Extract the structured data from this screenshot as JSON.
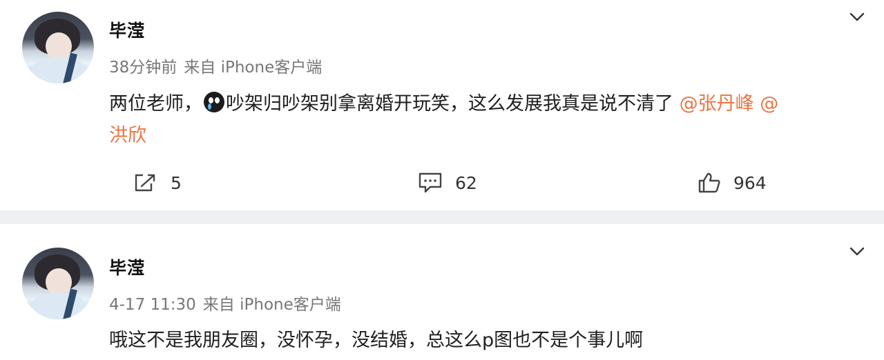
{
  "posts": [
    {
      "author": "毕滢",
      "time": "38分钟前",
      "source": "来自 iPhone客户端",
      "text_line1_a": "两位老师，",
      "text_line1_b": "吵架归吵架别拿离婚开玩笑，这么发展我真是说不清了",
      "mention1": "@张丹峰",
      "mention2_a": "@",
      "mention2_b": "洪欣",
      "actions": {
        "repost": "5",
        "comment": "62",
        "like": "964"
      }
    },
    {
      "author": "毕滢",
      "time": "4-17 11:30",
      "source": "来自 iPhone客户端",
      "text": "哦这不是我朋友圈，没怀孕，没结婚，总这么p图也不是个事儿啊"
    }
  ],
  "colors": {
    "mention": "#eb7340",
    "meta": "#777777",
    "divider": "#eef0f3"
  }
}
